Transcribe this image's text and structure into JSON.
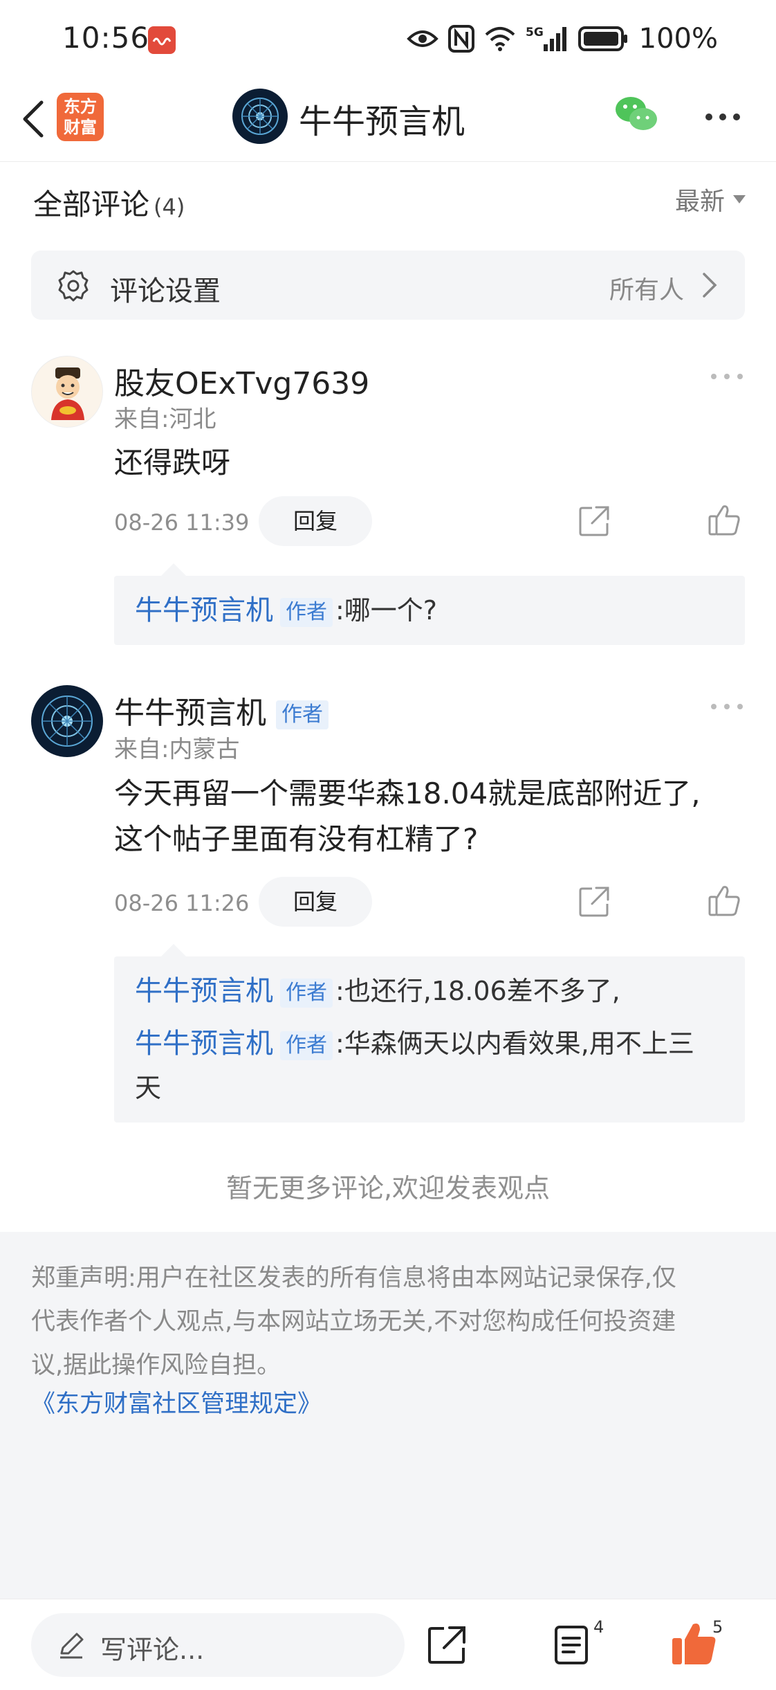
{
  "status_bar": {
    "time": "10:56",
    "network": "5G",
    "battery": "100%"
  },
  "nav": {
    "app_logo_text": "东方财富",
    "title": "牛牛预言机"
  },
  "comments_header": {
    "title": "全部评论",
    "count": "(4)",
    "sort_label": "最新"
  },
  "settings": {
    "label": "评论设置",
    "value": "所有人"
  },
  "comments": [
    {
      "username": "股友OExTvg7639",
      "is_author": false,
      "location": "来自:河北",
      "text": "还得跌呀",
      "time": "08-26 11:39",
      "reply_label": "回复",
      "replies": [
        {
          "name": "牛牛预言机",
          "tag": "作者",
          "text": ":哪一个?"
        }
      ]
    },
    {
      "username": "牛牛预言机",
      "is_author": true,
      "author_tag": "作者",
      "location": "来自:内蒙古",
      "text_line1": "今天再留一个需要华森18.04就是底部附近了,",
      "text_line2": "这个帖子里面有没有杠精了?",
      "time": "08-26 11:26",
      "reply_label": "回复",
      "replies": [
        {
          "name": "牛牛预言机",
          "tag": "作者",
          "text": ":也还行,18.06差不多了,"
        },
        {
          "name": "牛牛预言机",
          "tag": "作者",
          "text": ":华森俩天以内看效果,用不上三",
          "text_cont": "天"
        }
      ]
    }
  ],
  "no_more_text": "暂无更多评论,欢迎发表观点",
  "disclaimer": {
    "line1": "郑重声明:用户在社区发表的所有信息将由本网站记录保存,仅",
    "line2": "代表作者个人观点,与本网站立场无关,不对您构成任何投资建",
    "line3": "议,据此操作风险自担。",
    "rules_link": "《东方财富社区管理规定》"
  },
  "bottom_bar": {
    "comment_placeholder": "写评论...",
    "comment_count": "4",
    "like_count": "5"
  },
  "colors": {
    "accent_blue": "#2f6fc6",
    "like_orange": "#f0693a",
    "app_red": "#e24a3b"
  }
}
